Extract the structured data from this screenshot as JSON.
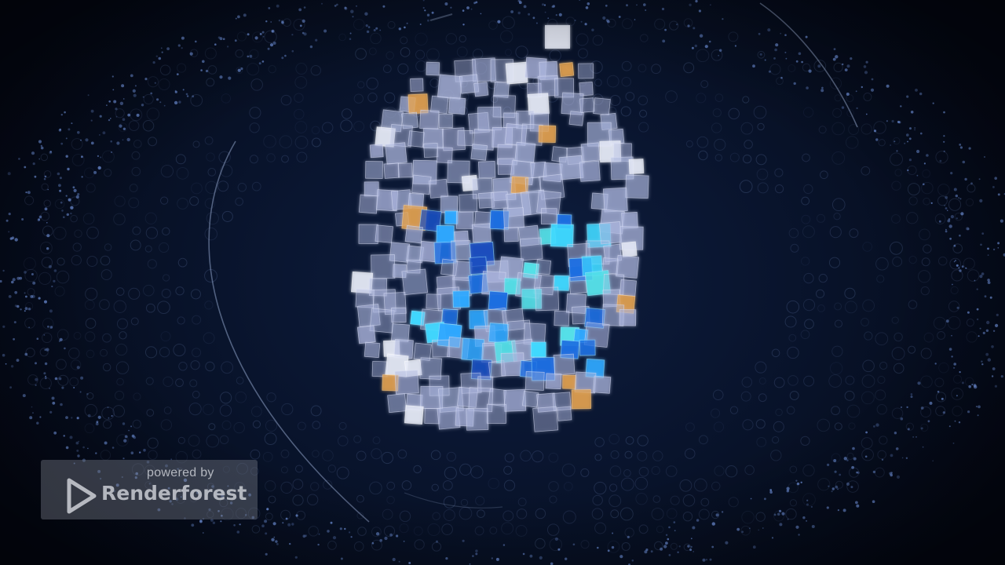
{
  "watermark": {
    "line1": "powered by",
    "line2": "Renderforest",
    "icon": "play-triangle-icon"
  },
  "colors": {
    "background": "#071024",
    "accent_blue": "#2fa8ff",
    "accent_cyan": "#3fd8ff",
    "accent_orange": "#e0a050",
    "tile_white": "#cfd6f0"
  }
}
